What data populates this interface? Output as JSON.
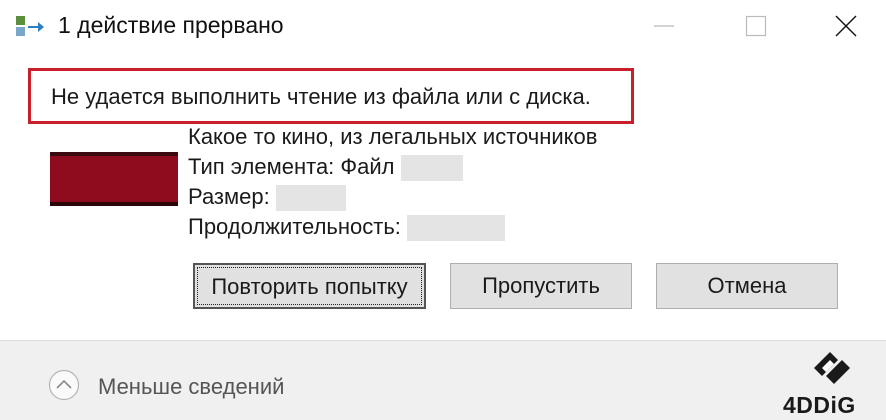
{
  "window": {
    "title": "1 действие прервано",
    "icons": {
      "app": "file-copy-icon",
      "minimize": "minimize-icon",
      "maximize": "maximize-icon",
      "close": "close-icon"
    }
  },
  "error": {
    "message": "Не удается выполнить чтение из файла или с диска.",
    "highlight_color": "#c8202a"
  },
  "item": {
    "name": "Какое то кино, из легальных источников",
    "type_label": "Тип элемента: Файл",
    "size_label": "Размер:",
    "duration_label": "Продолжительность:"
  },
  "buttons": {
    "retry": "Повторить попытку",
    "skip": "Пропустить",
    "cancel": "Отмена"
  },
  "footer": {
    "details_toggle": "Меньше сведений",
    "details_icon": "chevron-up-circle-icon"
  },
  "watermark": {
    "text": "4DDiG",
    "icon": "4ddig-logo-icon"
  }
}
